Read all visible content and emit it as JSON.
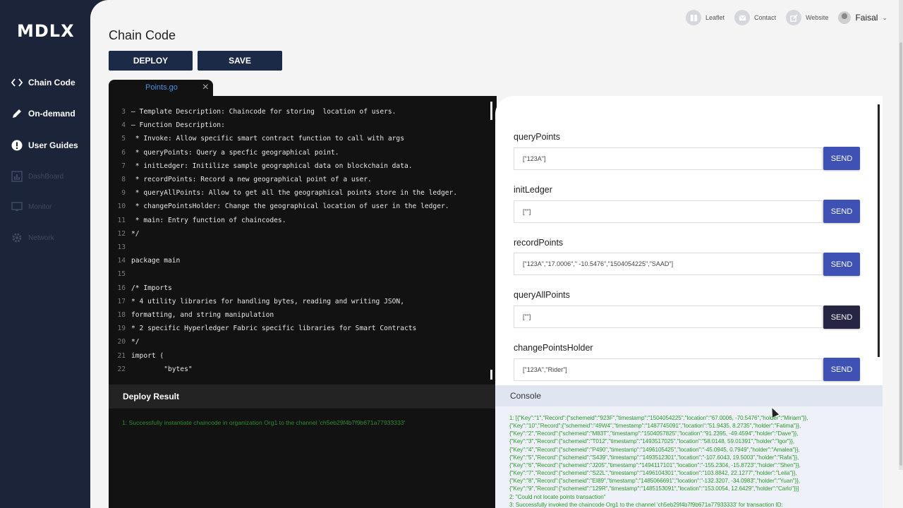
{
  "app": {
    "logo": "MDLX"
  },
  "sidebar": {
    "items": [
      {
        "label": "Chain Code",
        "icon": "code-icon",
        "enabled": true
      },
      {
        "label": "On-demand",
        "icon": "pencil-icon",
        "enabled": true
      },
      {
        "label": "User Guides",
        "icon": "info-icon",
        "enabled": true
      },
      {
        "label": "DashBoard",
        "icon": "dashboard-icon",
        "enabled": false
      },
      {
        "label": "Monitor",
        "icon": "monitor-icon",
        "enabled": false
      },
      {
        "label": "Network",
        "icon": "gear-icon",
        "enabled": false
      }
    ]
  },
  "header": {
    "title": "Chain Code",
    "links": [
      {
        "label": "Leaflet",
        "icon": "leaflet-icon"
      },
      {
        "label": "Contact",
        "icon": "mail-icon"
      },
      {
        "label": "Website",
        "icon": "external-link-icon"
      }
    ],
    "user": {
      "name": "Faisal"
    }
  },
  "toolbar": {
    "deploy_label": "DEPLOY",
    "save_label": "SAVE"
  },
  "editor": {
    "tab_name": "Points.go",
    "lines": [
      {
        "n": "3",
        "text": "– Template Description: Chaincode for storing  location of users."
      },
      {
        "n": "4",
        "text": "– Function Description:"
      },
      {
        "n": "5",
        "text": " * Invoke: Allow specific smart contract function to call with args"
      },
      {
        "n": "6",
        "text": " * queryPoints: Query a specfic geographical point."
      },
      {
        "n": "7",
        "text": " * initLedger: Initilize sample geographical data on blockchain data."
      },
      {
        "n": "8",
        "text": " * recordPoints: Record a new geographical point of a user."
      },
      {
        "n": "9",
        "text": " * queryAllPoints: Allow to get all the geographical points store in the ledger."
      },
      {
        "n": "10",
        "text": " * changePointsHolder: Change the geographical location of user in the ledger."
      },
      {
        "n": "11",
        "text": " * main: Entry function of chaincodes."
      },
      {
        "n": "12",
        "text": "*/"
      },
      {
        "n": "13",
        "text": ""
      },
      {
        "n": "14",
        "text": "package main"
      },
      {
        "n": "15",
        "text": ""
      },
      {
        "n": "16",
        "text": "/* Imports"
      },
      {
        "n": "17",
        "text": "* 4 utility libraries for handling bytes, reading and writing JSON,"
      },
      {
        "n": "18",
        "text": "formatting, and string manipulation"
      },
      {
        "n": "19",
        "text": "* 2 specific Hyperledger Fabric specific libraries for Smart Contracts"
      },
      {
        "n": "20",
        "text": "*/"
      },
      {
        "n": "21",
        "text": "import ("
      },
      {
        "n": "22",
        "text": "        \"bytes\""
      }
    ]
  },
  "functions": [
    {
      "name": "queryPoints",
      "value": "[\"123A\"]",
      "send": "SEND"
    },
    {
      "name": "initLedger",
      "value": "[\"\"]",
      "send": "SEND"
    },
    {
      "name": "recordPoints",
      "value": "[\"123A\",\"17.0006\",\" -10.5476\",\"1504054225\",\"SAAD\"]",
      "send": "SEND"
    },
    {
      "name": "queryAllPoints",
      "value": "[\"\"]",
      "send": "SEND"
    },
    {
      "name": "changePointsHolder",
      "value": "[\"123A\",\"Rider\"]",
      "send": "SEND"
    }
  ],
  "deploy_result": {
    "title": "Deploy Result",
    "message": "1: Successfully instantiate chaincode in organization Org1 to the channel 'ch5eb29f4b7f9b671a77933333'"
  },
  "console": {
    "title": "Console",
    "lines": [
      "1: [{\"Key\":\"1\",\"Record\":{\"schemeid\":\"923F\",\"timestamp\":\"1504054225\",\"location\":\"67.0006, -70.5476\",\"holder\":\"Miriam\"}},",
      "{\"Key\":\"10\",\"Record\":{\"schemeid\":\"49W4\",\"timestamp\":\"1487745091\",\"location\":\"51.9435, 8.2735\",\"holder\":\"Fatima\"}},",
      "{\"Key\":\"2\",\"Record\":{\"schemeid\":\"M83T\",\"timestamp\":\"1504057825\",\"location\":\"91.2395, -49.4594\",\"holder\":\"Dave\"}},",
      "{\"Key\":\"3\",\"Record\":{\"schemeid\":\"T012\",\"timestamp\":\"1493517025\",\"location\":\"58.0148, 59.01391\",\"holder\":\"Igor\"}},",
      "{\"Key\":\"4\",\"Record\":{\"schemeid\":\"P490\",\"timestamp\":\"1496105425\",\"location\":\"-45.0945, 0.7949\",\"holder\":\"Amalea\"}},",
      "{\"Key\":\"5\",\"Record\":{\"schemeid\":\"S439\",\"timestamp\":\"1493512301\",\"location\":\"-107.6043, 19.5003\",\"holder\":\"Rafa\"}},",
      "{\"Key\":\"6\",\"Record\":{\"schemeid\":\"J205\",\"timestamp\":\"1494117101\",\"location\":\"-155.2304, -15.8723\",\"holder\":\"Shen\"}},",
      "{\"Key\":\"7\",\"Record\":{\"schemeid\":\"S22L\",\"timestamp\":\"1496104301\",\"location\":\"103.8842, 22.1277\",\"holder\":\"Leila\"}},",
      "{\"Key\":\"8\",\"Record\":{\"schemeid\":\"EI89\",\"timestamp\":\"1485066691\",\"location\":\"-132.3207, -34.0983\",\"holder\":\"Yuan\"}},",
      "{\"Key\":\"9\",\"Record\":{\"schemeid\":\"129R\",\"timestamp\":\"1485153091\",\"location\":\"153.0054, 12.6429\",\"holder\":\"Carlo\"}}]",
      "2: \"Could not locate points transaction\"",
      "3: Successfully invoked the chaincode Org1 to the channel 'ch5eb29f4b7f9b671a77933333' for transaction ID:"
    ]
  },
  "colors": {
    "sidebar": "#1b2438",
    "primary_button": "#1b2a47",
    "send_button": "#3f51b5",
    "send_active": "#272544",
    "success_text": "#2e9b2e"
  }
}
